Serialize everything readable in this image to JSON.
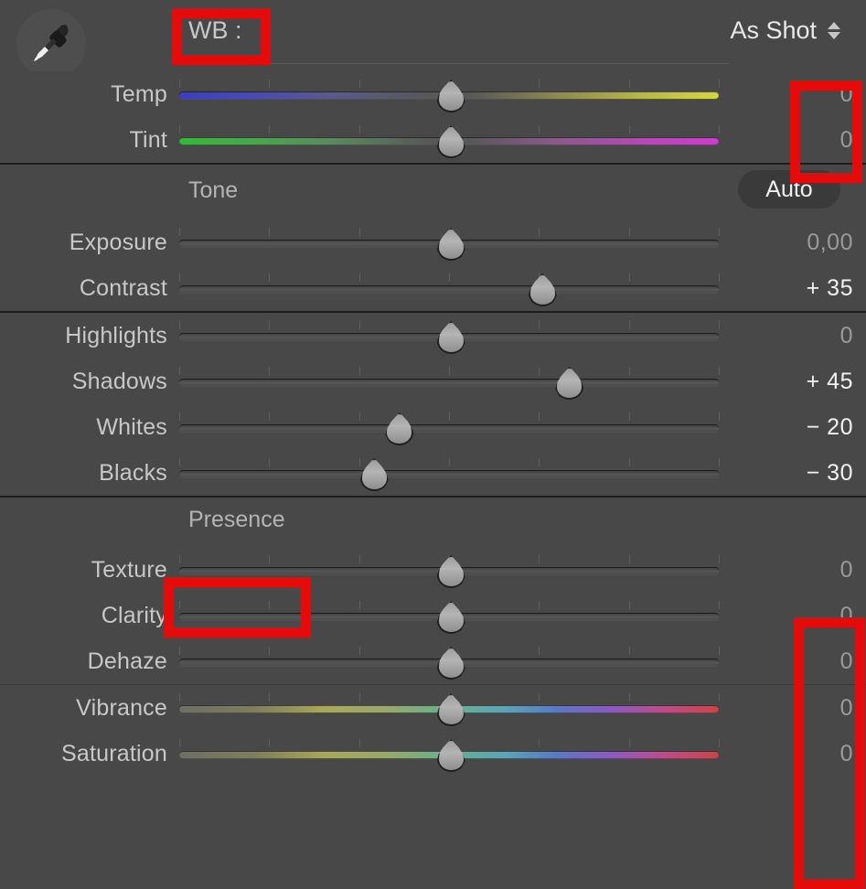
{
  "header": {
    "eyedropper_icon": "eyedropper-icon",
    "wb_label": "WB :",
    "preset_value": "As Shot",
    "spinner_icon": "up-down-spinner-icon"
  },
  "tone": {
    "title": "Tone",
    "auto_label": "Auto"
  },
  "presence": {
    "title": "Presence"
  },
  "sliders": {
    "wb": [
      {
        "label": "Temp",
        "value": "0",
        "pos": 50.0,
        "state": "zero",
        "track": "temp"
      },
      {
        "label": "Tint",
        "value": "0",
        "pos": 50.0,
        "state": "zero",
        "track": "tint"
      }
    ],
    "tone": [
      {
        "label": "Exposure",
        "value": "0,00",
        "pos": 50.0,
        "state": "zero",
        "track": "plain"
      },
      {
        "label": "Contrast",
        "value": "+ 35",
        "pos": 67.0,
        "state": "set",
        "track": "plain"
      }
    ],
    "tone2": [
      {
        "label": "Highlights",
        "value": "0",
        "pos": 50.0,
        "state": "zero",
        "track": "plain"
      },
      {
        "label": "Shadows",
        "value": "+ 45",
        "pos": 72.0,
        "state": "set",
        "track": "plain"
      },
      {
        "label": "Whites",
        "value": "− 20",
        "pos": 40.5,
        "state": "set",
        "track": "plain"
      },
      {
        "label": "Blacks",
        "value": "− 30",
        "pos": 35.8,
        "state": "set",
        "track": "plain"
      }
    ],
    "presence": [
      {
        "label": "Texture",
        "value": "0",
        "pos": 50.0,
        "state": "zero",
        "track": "plain"
      },
      {
        "label": "Clarity",
        "value": "0",
        "pos": 50.0,
        "state": "zero",
        "track": "plain"
      },
      {
        "label": "Dehaze",
        "value": "0",
        "pos": 50.0,
        "state": "zero",
        "track": "plain"
      }
    ],
    "color": [
      {
        "label": "Vibrance",
        "value": "0",
        "pos": 50.0,
        "state": "zero",
        "track": "rainbow"
      },
      {
        "label": "Saturation",
        "value": "0",
        "pos": 50.0,
        "state": "zero",
        "track": "rainbow"
      }
    ]
  },
  "annotations": {
    "color": "#e60b0b",
    "boxes": [
      "wb-label-box",
      "wb-values-box",
      "presence-label-box",
      "presence-values-box"
    ]
  }
}
